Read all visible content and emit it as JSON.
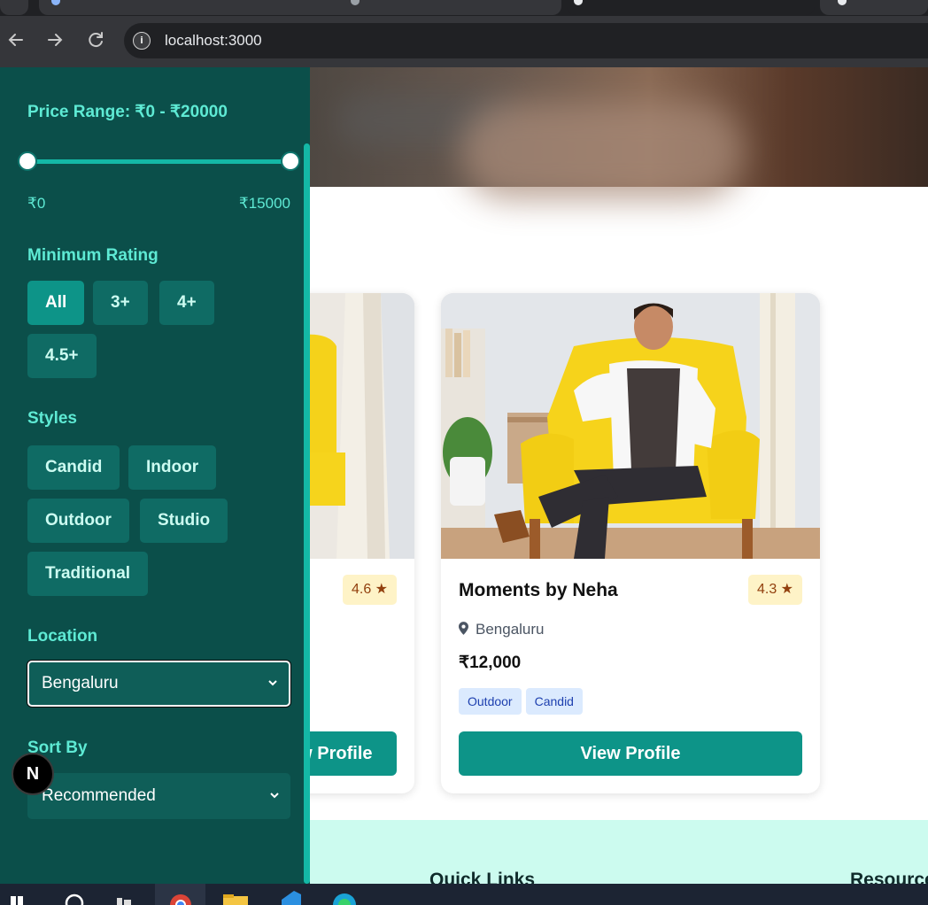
{
  "browser": {
    "url": "localhost:3000",
    "nav": {
      "back_icon": "arrow-left-icon",
      "forward_icon": "arrow-right-icon",
      "reload_icon": "reload-icon",
      "info_icon": "site-info-icon"
    }
  },
  "filters": {
    "price_range_label": "Price Range: ₹0 - ₹20000",
    "price_min_label": "₹0",
    "price_max_label": "₹15000",
    "price_min_value": 0,
    "price_max_value": 15000,
    "rating_label": "Minimum Rating",
    "ratings": [
      "All",
      "3+",
      "4+",
      "4.5+"
    ],
    "selected_rating": "All",
    "styles_label": "Styles",
    "styles": [
      "Candid",
      "Indoor",
      "Outdoor",
      "Studio",
      "Traditional"
    ],
    "location_label": "Location",
    "location_value": "Bengaluru",
    "sort_label": "Sort By",
    "sort_value": "Recommended"
  },
  "cards": [
    {
      "name": "",
      "rating": "4.6 ★",
      "button": "View Profile"
    },
    {
      "name": "Moments by Neha",
      "rating": "4.3 ★",
      "location": "Bengaluru",
      "price": "₹12,000",
      "tags": [
        "Outdoor",
        "Candid"
      ],
      "button": "View Profile"
    }
  ],
  "footer": {
    "quick_links": "Quick Links",
    "resources": "Resource"
  },
  "dev_badge": "N",
  "colors": {
    "sidebar_bg": "#0b4f4a",
    "accent": "#0d9488",
    "label": "#5eead4",
    "rating_badge_bg": "#fef3c7",
    "tag_bg": "#dbeafe",
    "footer_bg": "#ccfbef"
  }
}
